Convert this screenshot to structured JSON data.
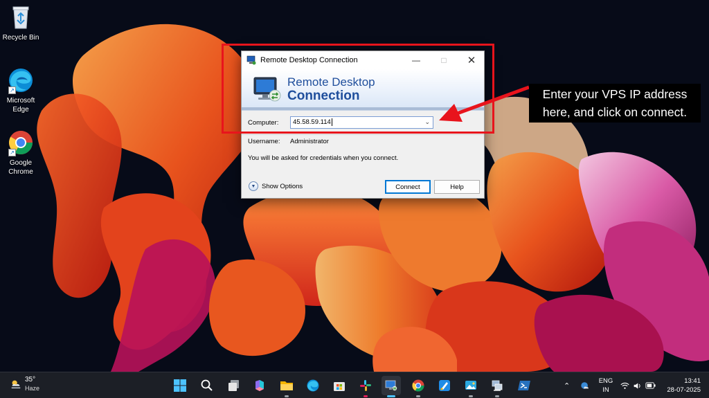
{
  "desktop": {
    "icons": [
      {
        "label": "Recycle Bin"
      },
      {
        "label": "Microsoft Edge"
      },
      {
        "label": "Google Chrome"
      }
    ]
  },
  "dialog": {
    "title": "Remote Desktop Connection",
    "banner_line1": "Remote Desktop",
    "banner_line2": "Connection",
    "computer_label": "Computer:",
    "computer_value": "45.58.59.114",
    "username_label": "Username:",
    "username_value": "Administrator",
    "credentials_note": "You will be asked for credentials when you connect.",
    "show_options_label": "Show Options",
    "connect_label": "Connect",
    "help_label": "Help"
  },
  "annotation": {
    "callout_text": "Enter your VPS IP address here, and click on connect.",
    "highlight_color": "#e8141c"
  },
  "taskbar": {
    "weather_temp": "35°",
    "weather_condition": "Haze",
    "pinned_icons": [
      "start-icon",
      "search-icon",
      "task-view-icon",
      "copilot-icon",
      "file-explorer-icon",
      "edge-icon",
      "store-icon",
      "slack-icon",
      "remote-desktop-icon",
      "chrome-icon",
      "paint-icon",
      "photos-icon",
      "network-manager-icon",
      "powershell-icon"
    ],
    "active_app": "remote-desktop-icon",
    "language_line1": "ENG",
    "language_line2": "IN",
    "time": "13:41",
    "date": "28-07-2025"
  },
  "colors": {
    "accent": "#0078d4",
    "banner_text": "#1f4e9c"
  }
}
